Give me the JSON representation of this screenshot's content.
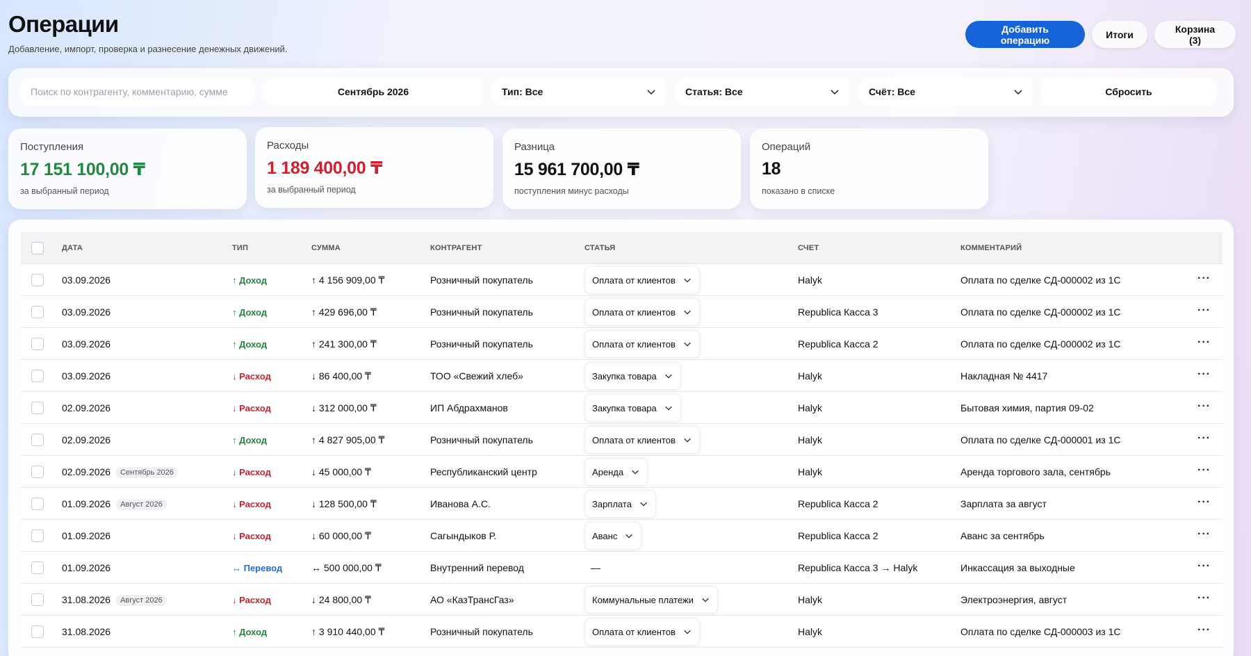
{
  "header": {
    "title": "Операции",
    "subtitle": "Добавление, импорт, проверка и разнесение денежных движений.",
    "add_button": "Добавить операцию",
    "totals_button": "Итоги",
    "cart_button": "Корзина (3)"
  },
  "filters": {
    "search_placeholder": "Поиск по контрагенту, комментарию, сумме",
    "period": "Сентябрь 2026",
    "type": "Тип: Все",
    "category": "Статья: Все",
    "account": "Счёт: Все",
    "reset": "Сбросить"
  },
  "summary": {
    "income": {
      "label": "Поступления",
      "value": "17 151 100,00 ₸",
      "note": "за выбранный период"
    },
    "expense": {
      "label": "Расходы",
      "value": "1 189 400,00 ₸",
      "note": "за выбранный период"
    },
    "diff": {
      "label": "Разница",
      "value": "15 961 700,00 ₸",
      "note": "поступления минус расходы"
    },
    "count": {
      "label": "Операций",
      "value": "18",
      "note": "показано в списке"
    }
  },
  "table": {
    "columns": [
      "ДАТА",
      "ТИП",
      "СУММА",
      "КОНТРАГЕНТ",
      "СТАТЬЯ",
      "СЧЕТ",
      "КОММЕНТАРИЙ"
    ],
    "rows": [
      {
        "date": "03.09.2026",
        "tag": "",
        "type": "↑ Доход",
        "kind": "income",
        "sum": "↑ 4 156 909,00 ₸",
        "counterparty": "Розничный покупатель",
        "category": "Оплата от клиентов",
        "account": "Halyk",
        "comment": "Оплата по сделке СД-000002 из 1С"
      },
      {
        "date": "03.09.2026",
        "tag": "",
        "type": "↑ Доход",
        "kind": "income",
        "sum": "↑ 429 696,00 ₸",
        "counterparty": "Розничный покупатель",
        "category": "Оплата от клиентов",
        "account": "Republica Касса 3",
        "comment": "Оплата по сделке СД-000002 из 1С"
      },
      {
        "date": "03.09.2026",
        "tag": "",
        "type": "↑ Доход",
        "kind": "income",
        "sum": "↑ 241 300,00 ₸",
        "counterparty": "Розничный покупатель",
        "category": "Оплата от клиентов",
        "account": "Republica Касса 2",
        "comment": "Оплата по сделке СД-000002 из 1С"
      },
      {
        "date": "03.09.2026",
        "tag": "",
        "type": "↓ Расход",
        "kind": "expense",
        "sum": "↓ 86 400,00 ₸",
        "counterparty": "ТОО «Свежий хлеб»",
        "category": "Закупка товара",
        "account": "Halyk",
        "comment": "Накладная № 4417"
      },
      {
        "date": "02.09.2026",
        "tag": "",
        "type": "↓ Расход",
        "kind": "expense",
        "sum": "↓ 312 000,00 ₸",
        "counterparty": "ИП Абдрахманов",
        "category": "Закупка товара",
        "account": "Halyk",
        "comment": "Бытовая химия, партия 09-02"
      },
      {
        "date": "02.09.2026",
        "tag": "",
        "type": "↑ Доход",
        "kind": "income",
        "sum": "↑ 4 827 905,00 ₸",
        "counterparty": "Розничный покупатель",
        "category": "Оплата от клиентов",
        "account": "Halyk",
        "comment": "Оплата по сделке СД-000001 из 1С"
      },
      {
        "date": "02.09.2026",
        "tag": "Сентябрь 2026",
        "type": "↓ Расход",
        "kind": "expense",
        "sum": "↓ 45 000,00 ₸",
        "counterparty": "Республиканский центр",
        "category": "Аренда",
        "account": "Halyk",
        "comment": "Аренда торгового зала, сентябрь"
      },
      {
        "date": "01.09.2026",
        "tag": "Август 2026",
        "type": "↓ Расход",
        "kind": "expense",
        "sum": "↓ 128 500,00 ₸",
        "counterparty": "Иванова А.С.",
        "category": "Зарплата",
        "account": "Republica Касса 2",
        "comment": "Зарплата за август"
      },
      {
        "date": "01.09.2026",
        "tag": "",
        "type": "↓ Расход",
        "kind": "expense",
        "sum": "↓ 60 000,00 ₸",
        "counterparty": "Сагындыков Р.",
        "category": "Аванс",
        "account": "Republica Касса 2",
        "comment": "Аванс за сентябрь"
      },
      {
        "date": "01.09.2026",
        "tag": "",
        "type": "↔ Перевод",
        "kind": "transfer",
        "sum": "↔ 500 000,00 ₸",
        "counterparty": "Внутренний перевод",
        "category": "",
        "category_empty": "—",
        "account": "Republica Касса 3 → Halyk",
        "comment": "Инкассация за выходные"
      },
      {
        "date": "31.08.2026",
        "tag": "Август 2026",
        "type": "↓ Расход",
        "kind": "expense",
        "sum": "↓ 24 800,00 ₸",
        "counterparty": "АО «КазТрансГаз»",
        "category": "Коммунальные платежи",
        "account": "Halyk",
        "comment": "Электроэнергия, август"
      },
      {
        "date": "31.08.2026",
        "tag": "",
        "type": "↑ Доход",
        "kind": "income",
        "sum": "↑ 3 910 440,00 ₸",
        "counterparty": "Розничный покупатель",
        "category": "Оплата от клиентов",
        "account": "Halyk",
        "comment": "Оплата по сделке СД-000003 из 1С"
      }
    ],
    "row_menu": "···"
  },
  "colors": {
    "primary": "#1463d9",
    "income": "#1e8a3e",
    "expense": "#d41e2c",
    "transfer": "#1b6fe0"
  },
  "icons": [
    "chevron-down-icon",
    "checkbox-icon",
    "more-icon"
  ]
}
